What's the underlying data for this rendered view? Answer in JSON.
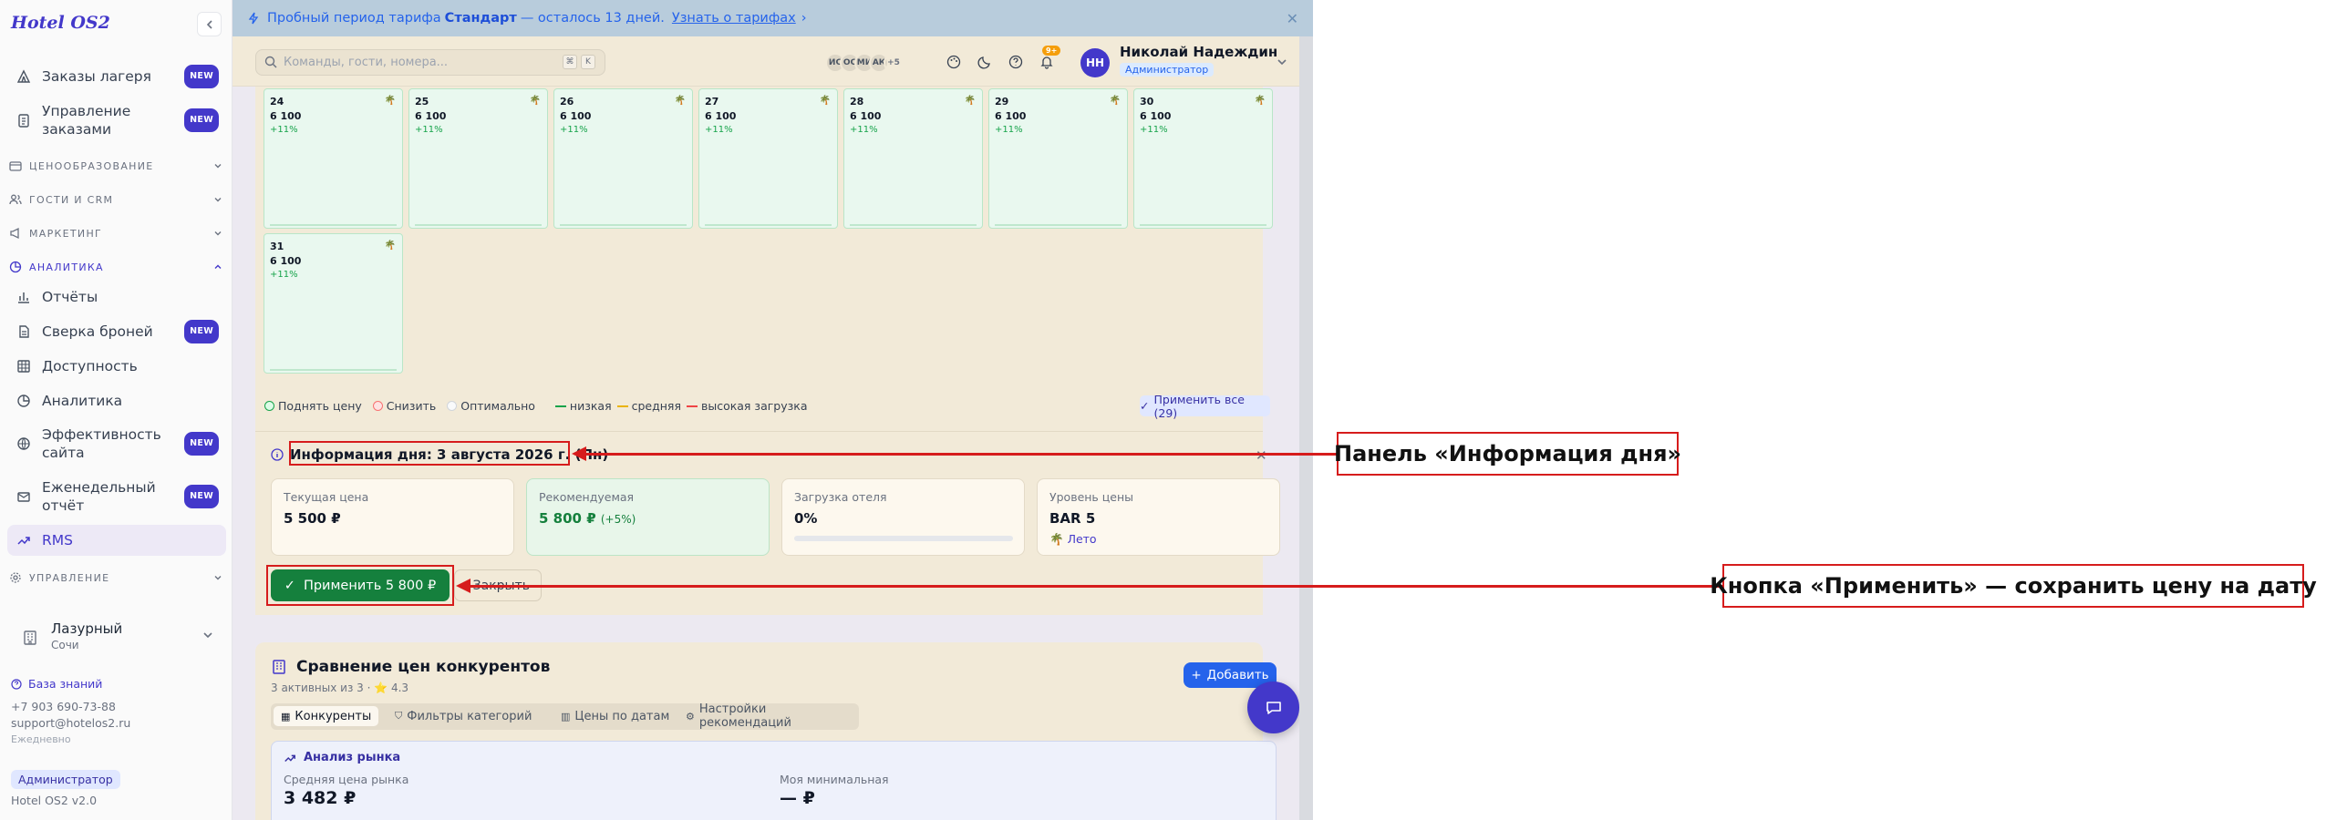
{
  "sidebar": {
    "brand": "Hotel OS2",
    "items": [
      {
        "label": "Заказы лагеря",
        "badge": "NEW",
        "icon": "tent-icon"
      },
      {
        "label": "Управление заказами",
        "badge": "NEW",
        "icon": "clipboard-icon"
      }
    ],
    "sections": {
      "pricing": "ЦЕНООБРАЗОВАНИЕ",
      "guests": "ГОСТИ И CRM",
      "marketing": "МАРКЕТИНГ",
      "analytics": "АНАЛИТИКА",
      "management": "УПРАВЛЕНИЕ"
    },
    "analytics_items": [
      {
        "label": "Отчёты",
        "badge": ""
      },
      {
        "label": "Сверка броней",
        "badge": "NEW"
      },
      {
        "label": "Доступность",
        "badge": ""
      },
      {
        "label": "Аналитика",
        "badge": ""
      },
      {
        "label": "Эффективность сайта",
        "badge": "NEW"
      },
      {
        "label": "Еженедельный отчёт",
        "badge": "NEW"
      },
      {
        "label": "RMS",
        "badge": ""
      }
    ],
    "hotel": {
      "name": "Лазурный",
      "city": "Сочи"
    },
    "footer": {
      "kb": "База знаний",
      "phone": "+7 903 690-73-88",
      "email": "support@hotelos2.ru",
      "schedule": "Ежедневно",
      "role": "Администратор",
      "version": "Hotel OS2 v2.0"
    }
  },
  "banner": {
    "prefix": "Пробный период тарифа",
    "plan": "Стандарт",
    "suffix": "— осталось 13 дней.",
    "link": "Узнать о тарифах"
  },
  "topbar": {
    "search_placeholder": "Команды, гости, номера...",
    "kbd1": "⌘",
    "kbd2": "K",
    "avatars": [
      "ИС",
      "ОС",
      "МИ",
      "АК",
      "+5"
    ],
    "notif_count": "9+",
    "user_initials": "НН",
    "user_name": "Николай Надеждин",
    "user_role": "Администратор"
  },
  "calendar": {
    "days": [
      {
        "day": "24",
        "price": "6 100",
        "change": "+11%"
      },
      {
        "day": "25",
        "price": "6 100",
        "change": "+11%"
      },
      {
        "day": "26",
        "price": "6 100",
        "change": "+11%"
      },
      {
        "day": "27",
        "price": "6 100",
        "change": "+11%"
      },
      {
        "day": "28",
        "price": "6 100",
        "change": "+11%"
      },
      {
        "day": "29",
        "price": "6 100",
        "change": "+11%"
      },
      {
        "day": "30",
        "price": "6 100",
        "change": "+11%"
      },
      {
        "day": "31",
        "price": "6 100",
        "change": "+11%"
      }
    ]
  },
  "legend": {
    "raise": "Поднять цену",
    "lower": "Снизить",
    "optimal": "Оптимально",
    "low": "низкая",
    "medium": "средняя",
    "high": "высокая загрузка",
    "apply_all": "Применить все (29)"
  },
  "day_info": {
    "title": "Информация дня: 3 августа 2026 г. (Пн)",
    "current_label": "Текущая цена",
    "current_value": "5 500 ₽",
    "rec_label": "Рекомендуемая",
    "rec_value": "5 800 ₽",
    "rec_delta": "(+5%)",
    "load_label": "Загрузка отеля",
    "load_value": "0%",
    "load_fraction": 0,
    "rate_label": "Уровень цены",
    "rate_value": "BAR 5",
    "rate_season": "Лето",
    "apply_btn": "Применить 5 800 ₽",
    "close_btn": "Закрыть"
  },
  "competitors": {
    "title": "Сравнение цен конкурентов",
    "subtitle": "3 активных из 3 · ⭐ 4.3",
    "add_btn": "Добавить",
    "tabs": [
      "Конкуренты",
      "Фильтры категорий",
      "Цены по датам",
      "Настройки рекомендаций"
    ],
    "market_title": "Анализ рынка",
    "avg_label": "Средняя цена рынка",
    "avg_value": "3 482 ₽",
    "my_min_label": "Моя минимальная",
    "my_min_value": "— ₽"
  },
  "annotations": {
    "panel_callout": "Панель «Информация дня»",
    "button_callout": "Кнопка «Применить» — сохранить цену на дату"
  },
  "colors": {
    "accent": "#4338ca",
    "success": "#16a34a",
    "annotation": "#d61c1c"
  }
}
